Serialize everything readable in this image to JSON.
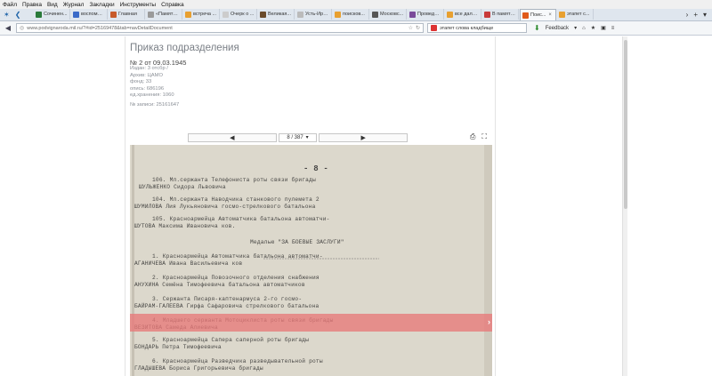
{
  "menu": [
    "Файл",
    "Правка",
    "Вид",
    "Журнал",
    "Закладки",
    "Инструменты",
    "Справка"
  ],
  "tabs": [
    {
      "label": "Сочинен...",
      "color": "#2a7a3a"
    },
    {
      "label": "воспомин...",
      "color": "#3a6ac8"
    },
    {
      "label": "Главная",
      "color": "#c85a2a"
    },
    {
      "label": "«Память - св...",
      "color": "#9a9a9a"
    },
    {
      "label": "встреча ...",
      "color": "#e8a030"
    },
    {
      "label": "Очерк о ...",
      "color": "#cccccc"
    },
    {
      "label": "Великая...",
      "color": "#6a4a2a"
    },
    {
      "label": "Усть-Ирбитс...",
      "color": "#bbbbbb"
    },
    {
      "label": "поисков...",
      "color": "#e8a030"
    },
    {
      "label": "Московс...",
      "color": "#555555"
    },
    {
      "label": "Проведение ...",
      "color": "#7a4a9a"
    },
    {
      "label": "все даль...",
      "color": "#e8a030"
    },
    {
      "label": "В память ...",
      "color": "#c83a3a"
    },
    {
      "label": "Поис...",
      "color": "#e05a1a",
      "active": true
    },
    {
      "label": "этапет с...",
      "color": "#e8a030"
    }
  ],
  "nav": {
    "url": "www.podvignaroda.mil.ru/?#id=25169478&tab=navDetailDocument",
    "search_text": "этапет слова кладбище",
    "feedback": "Feedback"
  },
  "document": {
    "title": "Приказ подразделения",
    "number_label": "№ 2 от 09.03.1945",
    "meta_lines": [
      "Издан: 3 отсбр /",
      "Архив: ЦАМО",
      "фонд: 33",
      "опись: 686196",
      "ед.хранения: 1060"
    ],
    "record_label": "№ записи: 25161647"
  },
  "viewer": {
    "prev_icon": "◀",
    "next_icon": "▶",
    "page": "8 / 387",
    "highlight_next": "›"
  },
  "scan_text": [
    "- 8 -",
    "106. Мл.сержанта                    Телефониста роты связи бригады",
    "ШУЛЬЖЕНКО Сидора Львовича",
    "104. Мл.сержанта                    Наводчика станкового пулемета 2",
    "ШУМИЛОВА Лия Лукьяновича             госмо-стрелкового батальона",
    "105. Красноармейца                  Автоматчика батальона автоматчи-",
    "ШУТОВА Максима Ивановича             ков.",
    "Медалью \"ЗА БОЕВЫЕ ЗАСЛУГИ\"",
    "1. Красноармейца                    Автоматчика батальона автоматчи-",
    "АГАНИЧЕВА Ивана Васильевича          ков",
    "2. Красноармейца                    Повозочного отделения снабжения",
    "АНУХИНА Семёна Тимофеевича           батальона автоматчиков",
    "3. Сержанта                         Писаря-каптенармуса 2-го госмо-",
    "БАЙРАМ-ГАЛЕЕВА Гирфа Сафаровича      стрелкового батальона",
    "4. Младшего сержанта                Мотоциклиста роты связи бригады",
    "ВЕЗИТОВА Самеда Алиевича",
    "5. Красноармейца                    Сапера саперной роты бригады",
    "БОНДАРЬ Петра Тимофеевича",
    "6. Красноармейца                    Разведчика разведывательной роты",
    "ГЛАДЫШЕВА Бориса Григорьевича        бригады"
  ],
  "colors": {
    "highlight": "#e87878",
    "scan_paper": "#dcd8cc"
  }
}
